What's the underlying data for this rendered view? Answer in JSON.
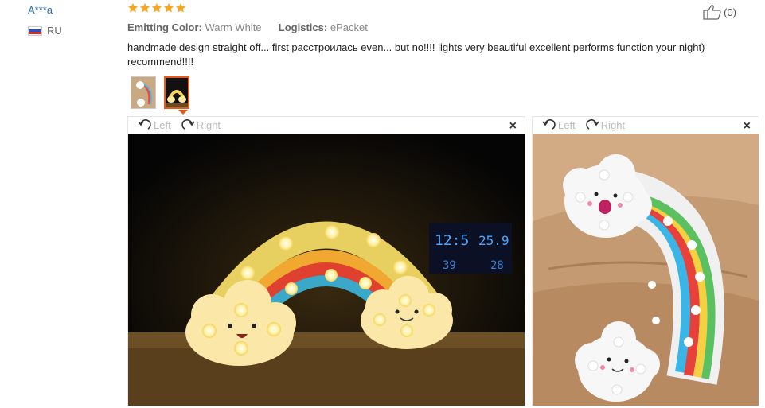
{
  "reviewer": {
    "name": "A***a",
    "country": "RU"
  },
  "rating": {
    "stars": 5,
    "max": 5,
    "color": "#f5a623"
  },
  "attributes": [
    {
      "key": "Emitting Color:",
      "value": "Warm White"
    },
    {
      "key": "Logistics:",
      "value": "ePacket"
    }
  ],
  "helpful": {
    "count": "(0)"
  },
  "review_text": "handmade design straight off... first расстроилась even... but no!!!! lights very beautiful excellent performs function your night) recommend!!!!",
  "viewer_controls": {
    "left": "Left",
    "right": "Right",
    "close": "×"
  },
  "accent_color": "#e55a1b",
  "link_color": "#2a6fb0"
}
